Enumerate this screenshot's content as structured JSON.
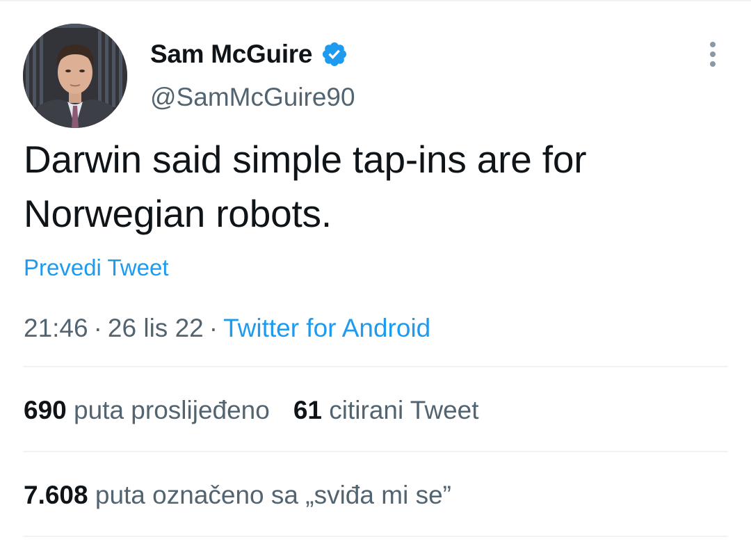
{
  "author": {
    "display_name": "Sam McGuire",
    "handle": "@SamMcGuire90"
  },
  "tweet": {
    "text": "Darwin said simple tap-ins are for Norwegian robots.",
    "translate_label": "Prevedi Tweet",
    "time": "21:46",
    "separator": "·",
    "date": "26 lis 22",
    "source": "Twitter for Android"
  },
  "stats": {
    "retweets_count": "690",
    "retweets_label": "puta proslijeđeno",
    "quotes_count": "61",
    "quotes_label": "citirani Tweet",
    "likes_count": "7.608",
    "likes_label": "puta označeno sa „sviđa mi se”"
  },
  "colors": {
    "accent": "#1d9bf0",
    "secondary_text": "#536471",
    "divider": "#eff3f4"
  },
  "icons": {
    "verified": "verified-badge-icon",
    "more": "more-vertical-icon"
  }
}
